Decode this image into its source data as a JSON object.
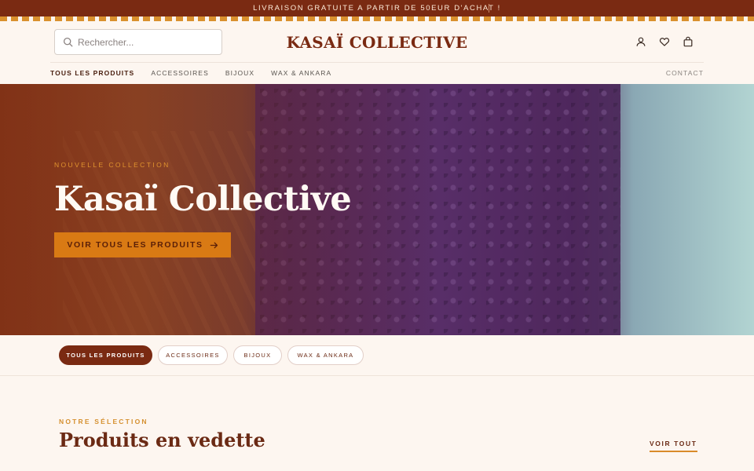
{
  "announcement": {
    "text": "LIVRAISON GRATUITE A PARTIR DE 50EUR D'ACHAT !"
  },
  "header": {
    "search_placeholder": "Rechercher...",
    "brand": "KASAÏ COLLECTIVE",
    "icons": [
      "user-icon",
      "heart-icon",
      "shopping-bag-icon"
    ]
  },
  "nav": {
    "items": [
      {
        "label": "TOUS LES PRODUITS",
        "active": true
      },
      {
        "label": "ACCESSOIRES",
        "active": false
      },
      {
        "label": "BIJOUX",
        "active": false
      },
      {
        "label": "WAX & ANKARA",
        "active": false
      }
    ],
    "contact": "CONTACT"
  },
  "hero": {
    "eyebrow": "NOUVELLE COLLECTION",
    "title": "Kasaï Collective",
    "cta_label": "VOIR TOUS LES PRODUITS",
    "cta_icon": "arrow-right-icon"
  },
  "filters": {
    "chips": [
      {
        "label": "TOUS LES PRODUITS",
        "active": true
      },
      {
        "label": "ACCESSOIRES",
        "active": false
      },
      {
        "label": "BIJOUX",
        "active": false
      },
      {
        "label": "WAX & ANKARA",
        "active": false
      }
    ]
  },
  "featured": {
    "eyebrow": "NOTRE SÉLECTION",
    "title": "Produits en vedette",
    "see_all": "VOIR TOUT"
  },
  "colors": {
    "brand": "#7a2a12",
    "accent": "#d97a14",
    "background": "#fdf6f0"
  }
}
